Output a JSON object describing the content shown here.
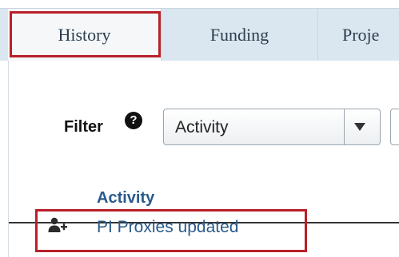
{
  "tabs": [
    {
      "label": "History"
    },
    {
      "label": "Funding"
    },
    {
      "label": "Proje"
    }
  ],
  "filter": {
    "label": "Filter",
    "help_glyph": "?",
    "select_value": "Activity"
  },
  "table": {
    "column_header": "Activity",
    "rows": [
      {
        "icon": "user-add-icon",
        "text": "PI Proxies updated"
      }
    ]
  },
  "colors": {
    "highlight": "#b8202a",
    "link": "#2a5a8a",
    "tabbar": "#dbe7f0"
  }
}
